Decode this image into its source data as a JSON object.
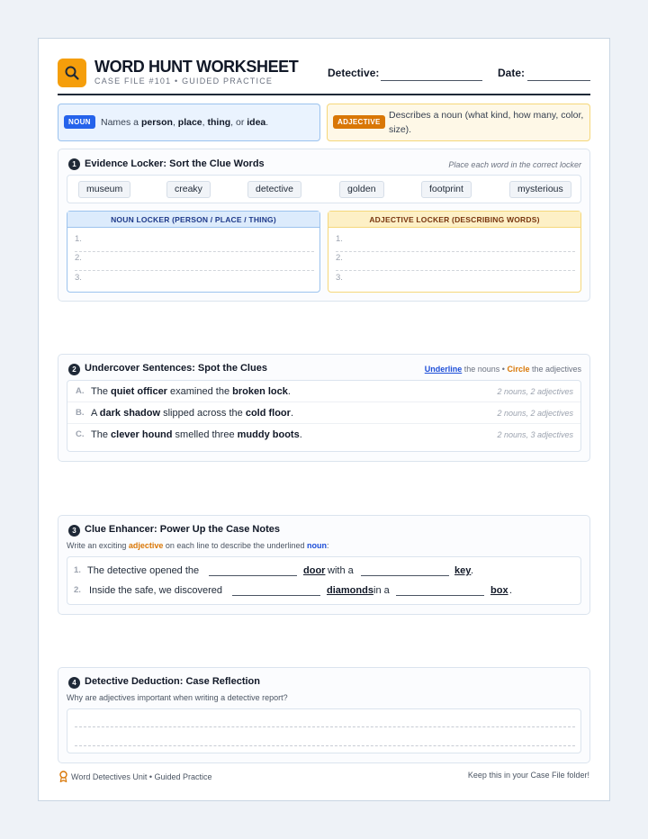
{
  "header": {
    "title": "WORD HUNT WORKSHEET",
    "subtitle": "CASE FILE #101 • GUIDED PRACTICE",
    "detective_label": "Detective:",
    "date_label": "Date:"
  },
  "definitions": {
    "noun": {
      "badge": "NOUN",
      "pre": "Names a ",
      "w1": "person",
      "c1": ", ",
      "w2": "place",
      "c2": ", ",
      "w3": "thing",
      "c3": ", or ",
      "w4": "idea",
      "end": "."
    },
    "adjective": {
      "badge": "ADJECTIVE",
      "text": "Describes a noun (what kind, how many, color, size)."
    }
  },
  "section1": {
    "num": "1",
    "title": "Evidence Locker: Sort the Clue Words",
    "hint": "Place each word in the correct locker",
    "words": [
      "museum",
      "creaky",
      "detective",
      "golden",
      "footprint",
      "mysterious"
    ],
    "noun_locker": "NOUN LOCKER (PERSON / PLACE / THING)",
    "adj_locker": "ADJECTIVE LOCKER (DESCRIBING WORDS)",
    "slots": [
      "1.",
      "2.",
      "3."
    ]
  },
  "section2": {
    "num": "2",
    "title": "Undercover Sentences: Spot the Clues",
    "hint_underline": "Underline",
    "hint_mid": " the nouns • ",
    "hint_circle": "Circle",
    "hint_end": " the adjectives",
    "sentences": [
      {
        "letter": "A.",
        "p1": "The ",
        "b1": "quiet officer",
        "p2": " examined the ",
        "b2": "broken lock",
        "p3": ".",
        "count": "2 nouns, 2 adjectives"
      },
      {
        "letter": "B.",
        "p1": "A ",
        "b1": "dark shadow",
        "p2": " slipped across the ",
        "b2": "cold floor",
        "p3": ".",
        "count": "2 nouns, 2 adjectives"
      },
      {
        "letter": "C.",
        "p1": "The ",
        "b1": "clever hound",
        "p2": " smelled three ",
        "b2": "muddy boots",
        "p3": ".",
        "count": "2 nouns, 3 adjectives"
      }
    ]
  },
  "section3": {
    "num": "3",
    "title": "Clue Enhancer: Power Up the Case Notes",
    "instr_pre": "Write an exciting ",
    "instr_adj": "adjective",
    "instr_mid": " on each line to describe the underlined ",
    "instr_noun": "noun",
    "instr_end": ":",
    "items": [
      {
        "num": "1.",
        "pre": "The detective opened the",
        "noun1": "door",
        "mid": "with a",
        "noun2": "key",
        "end": "."
      },
      {
        "num": "2.",
        "pre": "Inside the safe, we discovered",
        "noun1": "diamonds",
        "mid": "in a",
        "noun2": "box",
        "end": "."
      }
    ]
  },
  "section4": {
    "num": "4",
    "title": "Detective Deduction: Case Reflection",
    "question": "Why are adjectives important when writing a detective report?"
  },
  "footer": {
    "left": "Word Detectives Unit • Guided Practice",
    "right": "Keep this in your Case File folder!"
  },
  "colors": {
    "accent": "#f59e0b",
    "noun": "#2563eb",
    "adjective": "#d97706"
  },
  "icons": {
    "logo": "magnifier-icon",
    "footer": "award-ribbon-icon"
  }
}
